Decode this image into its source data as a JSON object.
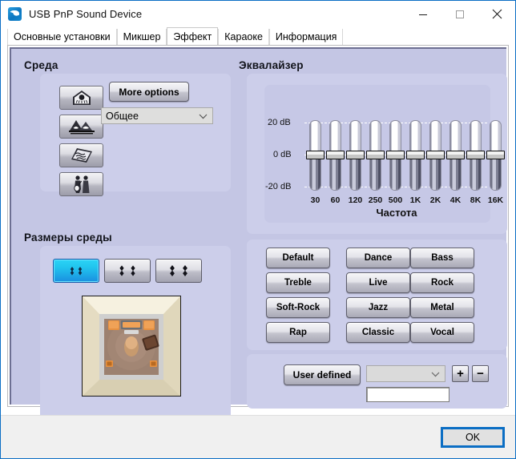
{
  "window": {
    "title": "USB PnP Sound Device",
    "icon": "speaker-icon",
    "controls": {
      "minimize": "–",
      "maximize": "□",
      "close": "✕"
    }
  },
  "tabs": [
    {
      "label": "Основные установки",
      "active": false
    },
    {
      "label": "Микшер",
      "active": false
    },
    {
      "label": "Эффект",
      "active": true
    },
    {
      "label": "Караоке",
      "active": false
    },
    {
      "label": "Информация",
      "active": false
    }
  ],
  "environment": {
    "title": "Среда",
    "icon_buttons": [
      {
        "name": "bathroom-icon",
        "label": "Bathroom"
      },
      {
        "name": "cave-icon",
        "label": "Cave"
      },
      {
        "name": "carpeted-hallway-icon",
        "label": "Carpeted hallway"
      },
      {
        "name": "concert-icon",
        "label": "Concert"
      }
    ],
    "more_options_label": "More options",
    "preset_value": "Общее"
  },
  "room_size": {
    "title": "Размеры среды",
    "buttons": [
      {
        "name": "room-small",
        "selected": true
      },
      {
        "name": "room-medium",
        "selected": false
      },
      {
        "name": "room-large",
        "selected": false
      }
    ],
    "preview_alt": "Room top-down preview"
  },
  "equalizer": {
    "title": "Эквалайзер",
    "x_axis_title": "Частота",
    "y_labels": [
      "20 dB",
      "0  dB",
      "-20 dB"
    ],
    "presets": [
      "Default",
      "Dance",
      "Bass",
      "Treble",
      "Live",
      "Rock",
      "Soft-Rock",
      "Jazz",
      "Metal",
      "Rap",
      "Classic",
      "Vocal"
    ],
    "user_defined_label": "User defined",
    "user_preset_value": "",
    "user_name_value": "",
    "add_label": "+",
    "remove_label": "−"
  },
  "chart_data": {
    "type": "bar",
    "title": "Эквалайзер",
    "xlabel": "Частота",
    "ylabel": "dB",
    "categories": [
      "30",
      "60",
      "120",
      "250",
      "500",
      "1K",
      "2K",
      "4K",
      "8K",
      "16K"
    ],
    "values": [
      0,
      0,
      0,
      0,
      0,
      0,
      0,
      0,
      0,
      0
    ],
    "ylim": [
      -20,
      20
    ],
    "yticks": [
      -20,
      0,
      20
    ],
    "ytick_labels": [
      "-20 dB",
      "0  dB",
      "20 dB"
    ],
    "grid": true,
    "legend": "none"
  },
  "footer": {
    "ok_label": "OK"
  }
}
